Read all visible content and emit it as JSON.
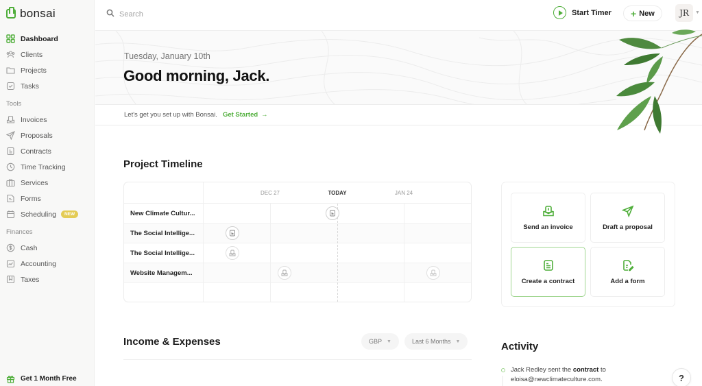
{
  "app": {
    "name": "bonsai",
    "brand_color": "#4fae3a"
  },
  "sidebar": {
    "main_items": [
      {
        "label": "Dashboard",
        "icon": "grid-icon",
        "active": true
      },
      {
        "label": "Clients",
        "icon": "users-icon"
      },
      {
        "label": "Projects",
        "icon": "folder-icon"
      },
      {
        "label": "Tasks",
        "icon": "checkbox-icon"
      }
    ],
    "tools_heading": "Tools",
    "tools_items": [
      {
        "label": "Invoices",
        "icon": "invoice-icon"
      },
      {
        "label": "Proposals",
        "icon": "send-icon"
      },
      {
        "label": "Contracts",
        "icon": "document-icon"
      },
      {
        "label": "Time Tracking",
        "icon": "clock-icon"
      },
      {
        "label": "Services",
        "icon": "briefcase-icon"
      },
      {
        "label": "Forms",
        "icon": "form-icon"
      },
      {
        "label": "Scheduling",
        "icon": "calendar-icon",
        "badge": "NEW"
      }
    ],
    "finances_heading": "Finances",
    "finances_items": [
      {
        "label": "Cash",
        "icon": "dollar-icon"
      },
      {
        "label": "Accounting",
        "icon": "chart-icon"
      },
      {
        "label": "Taxes",
        "icon": "bookmark-icon"
      }
    ],
    "promo": {
      "label": "Get 1 Month Free",
      "icon": "gift-icon"
    }
  },
  "topbar": {
    "search_placeholder": "Search",
    "start_timer_label": "Start Timer",
    "new_label": "New",
    "avatar_initials": "JR"
  },
  "hero": {
    "date": "Tuesday, January 10th",
    "greeting": "Good morning, Jack.",
    "setup_text": "Let's get you set up with Bonsai.",
    "get_started_label": "Get Started",
    "get_started_arrow": "→"
  },
  "timeline": {
    "title": "Project Timeline",
    "columns": [
      "DEC 27",
      "TODAY",
      "JAN 24"
    ],
    "rows": [
      {
        "label": "New Climate Cultur...",
        "markers": [
          {
            "type": "contract-icon"
          }
        ]
      },
      {
        "label": "The Social Intellige...",
        "markers": [
          {
            "type": "contract-icon"
          }
        ]
      },
      {
        "label": "The Social Intellige...",
        "markers": [
          {
            "type": "invoice-icon"
          }
        ]
      },
      {
        "label": "Website Managem...",
        "markers": [
          {
            "type": "invoice-icon"
          },
          {
            "type": "invoice-icon"
          }
        ]
      }
    ]
  },
  "quick_actions": [
    {
      "label": "Send an invoice",
      "icon": "invoice-icon"
    },
    {
      "label": "Draft a proposal",
      "icon": "send-icon"
    },
    {
      "label": "Create a contract",
      "icon": "document-icon",
      "selected": true
    },
    {
      "label": "Add a form",
      "icon": "form-edit-icon"
    }
  ],
  "income": {
    "title": "Income & Expenses",
    "currency": "GBP",
    "range": "Last 6 Months"
  },
  "activity": {
    "title": "Activity",
    "items": [
      {
        "prefix": "Jack Redley sent the",
        "bold": "contract",
        "suffix": "to eloisa@newclimateculture.com."
      }
    ]
  },
  "help": {
    "label": "?"
  }
}
